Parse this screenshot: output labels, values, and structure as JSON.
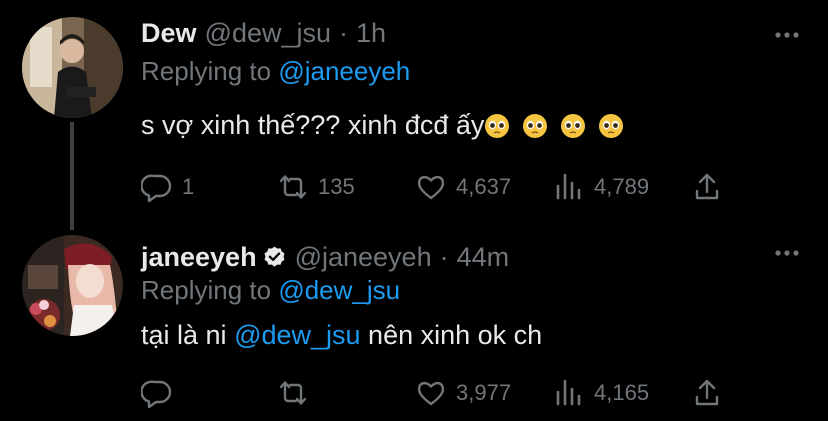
{
  "tweets": [
    {
      "author_name": "Dew",
      "author_handle": "@dew_jsu",
      "dot": "·",
      "time": "1h",
      "replying_prefix": "Replying to",
      "replying_to": "@janeeyeh",
      "text": "s vợ xinh thế??? xinh đcđ ấy",
      "emojis": [
        "pleading-face",
        "pleading-face",
        "pleading-face",
        "pleading-face"
      ],
      "verified": false,
      "replies": "1",
      "retweets": "135",
      "likes": "4,637",
      "views": "4,789"
    },
    {
      "author_name": "janeeyeh",
      "author_handle": "@janeeyeh",
      "dot": "·",
      "time": "44m",
      "replying_prefix": "Replying to",
      "replying_to": "@dew_jsu",
      "text_before": "tại là ni ",
      "text_mention": "@dew_jsu",
      "text_after": " nên xinh ok ch",
      "verified": true,
      "replies": "",
      "retweets": "",
      "likes": "3,977",
      "views": "4,165"
    }
  ],
  "colors": {
    "background": "#000000",
    "text": "#e7e9ea",
    "muted": "#71767b",
    "accent": "#1d9bf0",
    "thread_line": "#3e4144"
  }
}
